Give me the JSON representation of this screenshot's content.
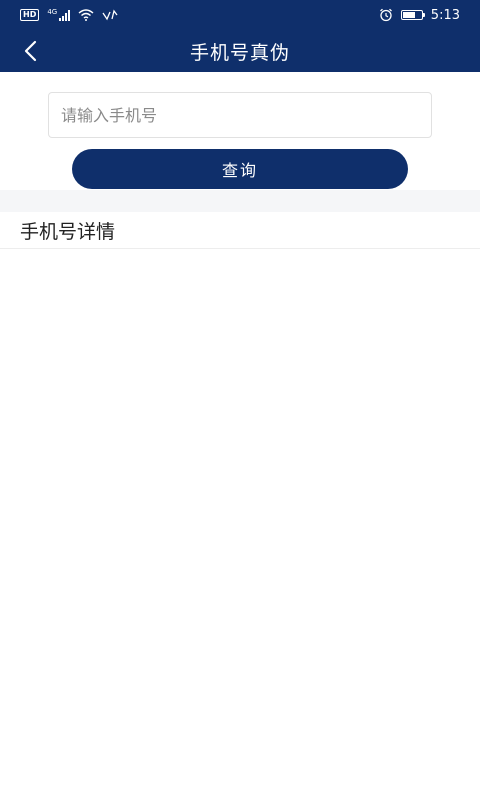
{
  "status_bar": {
    "hd": "HD",
    "network": "4G",
    "time": "5:13",
    "battery_level": 0.7
  },
  "nav": {
    "title": "手机号真伪"
  },
  "query": {
    "placeholder": "请输入手机号",
    "value": "",
    "button_label": "查询"
  },
  "details": {
    "title": "手机号详情"
  },
  "colors": {
    "primary": "#0f2f6b",
    "section_gap": "#f5f6f8"
  }
}
